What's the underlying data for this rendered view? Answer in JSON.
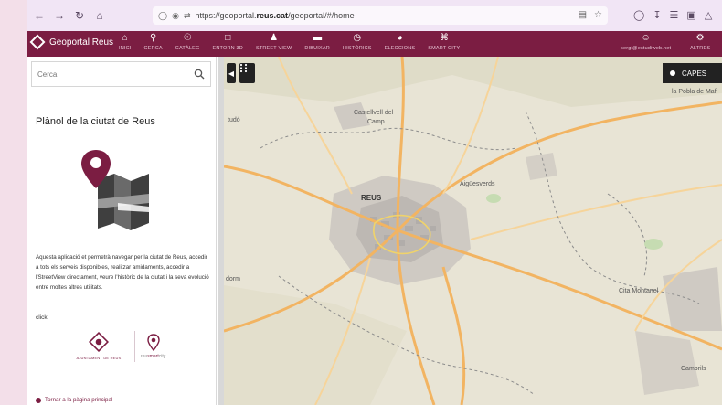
{
  "browser": {
    "url_prefix": "https://geoportal.",
    "url_domain": "reus.cat",
    "url_path": "/geoportal/#/home"
  },
  "header": {
    "app_name": "Geoportal Reus",
    "nav": [
      {
        "label": "INICI",
        "icon": "home-icon"
      },
      {
        "label": "CERCA",
        "icon": "search-icon"
      },
      {
        "label": "CATÀLEG",
        "icon": "compass-icon"
      },
      {
        "label": "ENTORN 3D",
        "icon": "cube-icon"
      },
      {
        "label": "STREET VIEW",
        "icon": "person-icon"
      },
      {
        "label": "DIBUIXAR",
        "icon": "draw-icon"
      },
      {
        "label": "HISTÒRICS",
        "icon": "clock-icon"
      },
      {
        "label": "ELECCIONS",
        "icon": "pie-icon"
      },
      {
        "label": "SMART CITY",
        "icon": "wifi-icon"
      }
    ],
    "user_label": "sergi@estudiweb.net",
    "altres_label": "ALTRES"
  },
  "sidebar": {
    "search_placeholder": "Cerca",
    "title": "Plànol de la ciutat de Reus",
    "description": "Aquesta aplicació et permetrà navegar per la ciutat de Reus, accedir a tots els serveis disponibles, realitzar amidaments, accedir a l'StreetView directament, veure l'històric de la ciutat i la seva evolució entre moltes altres utilitats.",
    "click_text": "click",
    "ajuntament_label": "AJUNTAMENT DE REUS",
    "smart_prefix": "reu",
    "smart_bold": "smart",
    "smart_suffix": "city",
    "return_link": "Tornar a la pàgina principal"
  },
  "map": {
    "capes_label": "CAPES",
    "labels": {
      "reus": "REUS",
      "castellvell": "Castellvell del",
      "camp": "Camp",
      "pobla": "la Pobla de Maf",
      "aiguesverds": "Aigüesverds",
      "cita": "Cita Montanel",
      "dorm": "dorm",
      "tudo": "tudó",
      "cambrils": "Cambrils"
    }
  },
  "colors": {
    "brand": "#7b1d42",
    "map_road": "#f2b462"
  }
}
